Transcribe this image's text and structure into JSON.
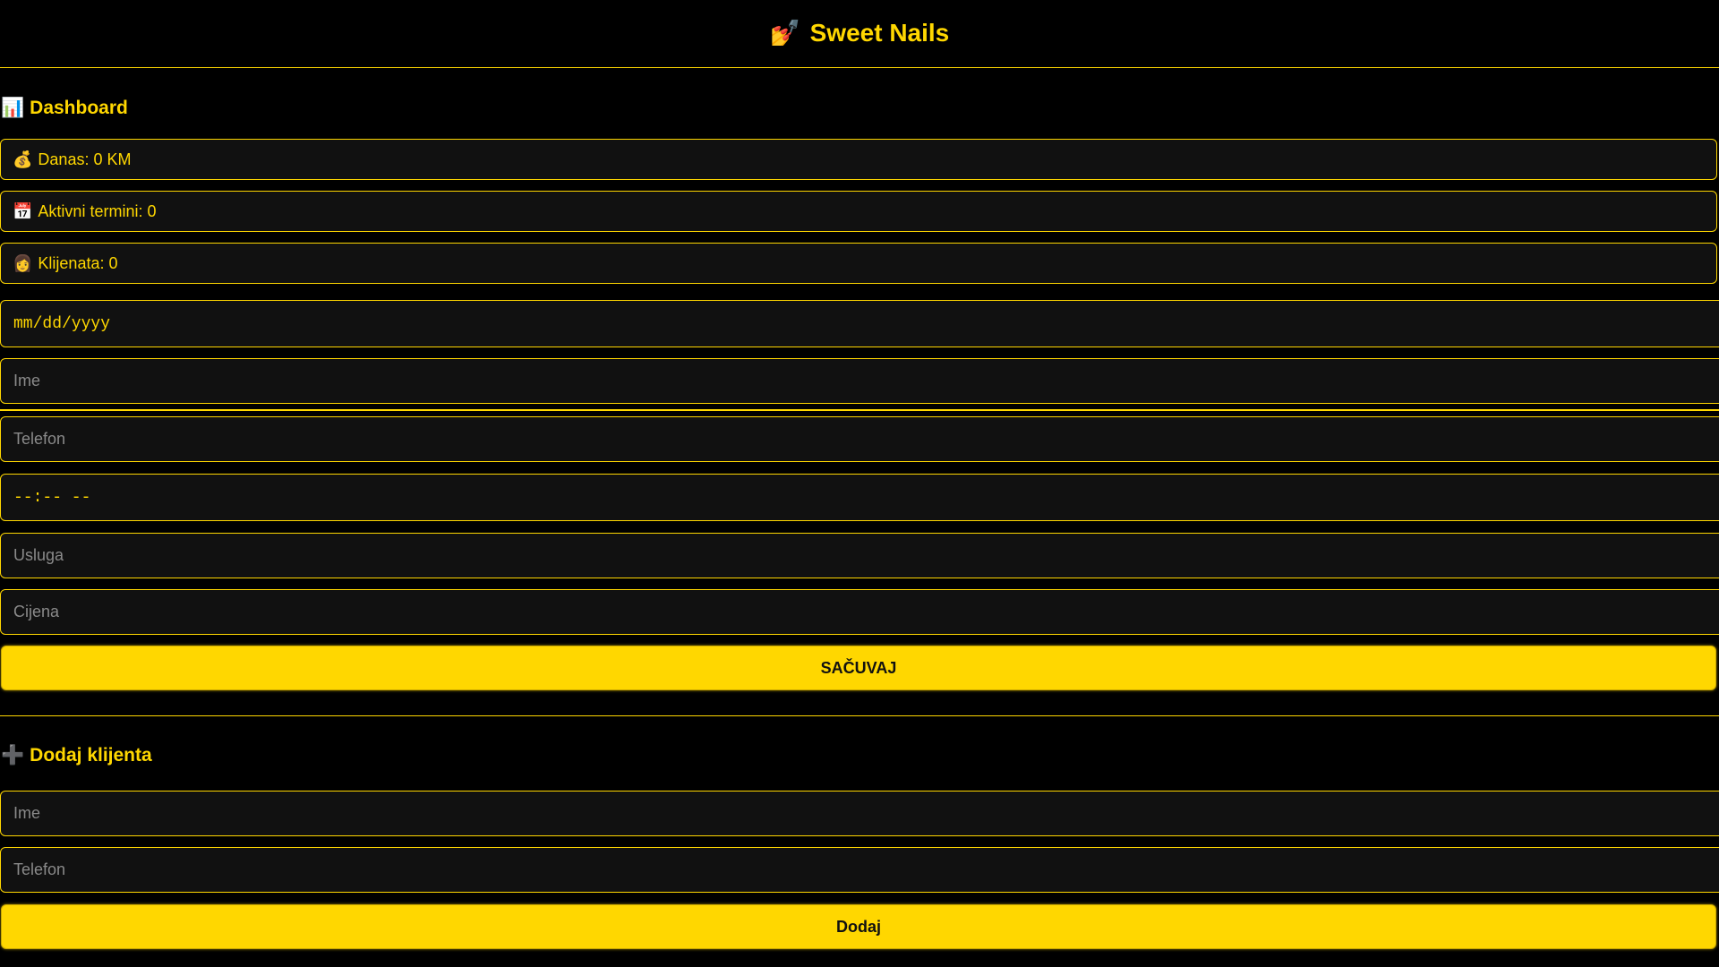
{
  "header": {
    "logo_icon": "💅",
    "title": "Sweet Nails"
  },
  "dashboard": {
    "icon": "📊",
    "title": "Dashboard",
    "stats": [
      {
        "icon": "💰",
        "label": "Danas: 0 KM"
      },
      {
        "icon": "📅",
        "label": "Aktivni termini: 0"
      },
      {
        "icon": "👩",
        "label": "Klijenata: 0"
      }
    ]
  },
  "appointment_form": {
    "date_placeholder": "mm/dd/yyyy",
    "name_placeholder": "Ime",
    "phone_placeholder": "Telefon",
    "time_placeholder": "--:-- --",
    "service_placeholder": "Usluga",
    "price_placeholder": "Cijena",
    "save_label": "SAČUVAJ"
  },
  "add_client": {
    "icon": "➕",
    "title": "Dodaj klijenta",
    "name_placeholder": "Ime",
    "phone_placeholder": "Telefon",
    "add_label": "Dodaj"
  },
  "colors": {
    "accent": "#FFD700",
    "background": "#000000",
    "field_background": "#111111",
    "placeholder": "#8a8a8a"
  }
}
